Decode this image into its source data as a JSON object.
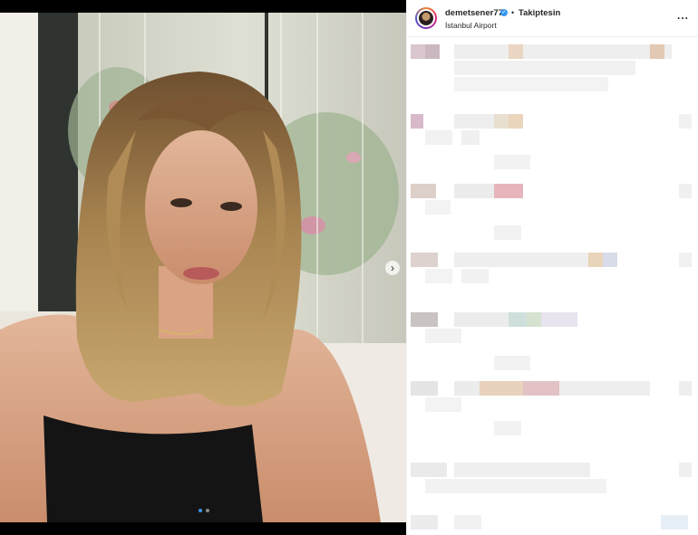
{
  "post": {
    "username": "demetsener77",
    "verified_icon": "verified-badge-icon",
    "bullet": "•",
    "follow_label": "Takiptesin",
    "location": "İstanbul Airport",
    "more_icon": "more-options-icon",
    "more_label": "...",
    "next_icon": "chevron-right-icon",
    "next_label": "›"
  },
  "carousel": {
    "current": 1,
    "total": 2
  },
  "comments": {
    "pixelated": true
  },
  "colors": {
    "text": "#262626",
    "verified": "#3897f0",
    "border": "#efefef"
  }
}
